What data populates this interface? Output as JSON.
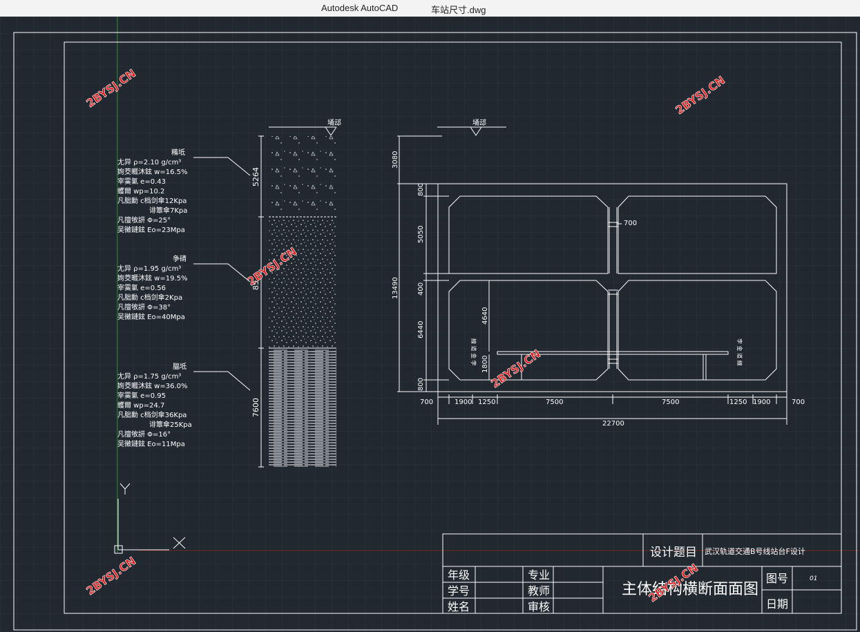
{
  "window": {
    "app_name": "Autodesk AutoCAD",
    "file_name": "车站尺寸.dwg"
  },
  "colors": {
    "background": "#212830",
    "grid": "#2a323c",
    "line": "#ffffff",
    "watermark_fill": "#e02020"
  },
  "watermark": "2BYSJ.CN",
  "ground_label": "埇䢵",
  "soil_column": {
    "depths": {
      "layer1": "5264",
      "layer2": "85",
      "layer3": "7600"
    },
    "layer1": {
      "name": "糒坻",
      "props": [
        "尢异 ρ=2.10 g/cm³",
        "姰茭畷沐鉉 w=16.5%",
        "宰霙氭 e=0.43",
        "蠖爾 wp=10.2",
        "凡朏勳 c档剑傘12Kpa",
        "诽簟傘7Kpa",
        "凡擅敂訮 Φ=25°",
        "吴黴鏈鉉 Eo=23Mpa"
      ]
    },
    "layer2": {
      "name": "争碃",
      "props": [
        "尢异 ρ=1.95 g/cm³",
        "姰茭畷沐鉉 w=19.5%",
        "宰霙氭 e=0.56",
        "凡朏勳 c档剑傘2Kpa",
        "凡擅敂訮 Φ=38°",
        "吴黴鏈鉉 Eo=40Mpa"
      ]
    },
    "layer3": {
      "name": "腷坻",
      "props": [
        "尢异 ρ=1.75 g/cm³",
        "姰茭畷沐鉉 w=36.0%",
        "宰霙氭 e=0.95",
        "蠖爾 wp=24.7",
        "凡朏勳 c档剑傘36Kpa",
        "诽簟傘25Kpa",
        "凡擅敂訮 Φ=16°",
        "吴黴鏈鉉 Eo=11Mpa"
      ]
    }
  },
  "station_section": {
    "dims_vertical": {
      "cover": "3080",
      "top_slab": "800",
      "upper_story": "5050",
      "mid_slab": "400",
      "lower_story": "6440",
      "bottom_slab": "800",
      "total_height": "13490",
      "inner_4640": "4640",
      "platform_1800": "1800"
    },
    "dims_horizontal": {
      "wall_left": "700",
      "track_left": "1900",
      "gap_left": "1250",
      "half_left": "7500",
      "half_right": "7500",
      "gap_right": "1250",
      "track_right": "1900",
      "wall_right": "700",
      "total_width": "22700"
    },
    "column_width": "700",
    "track_label_left": "線 道 金 孛",
    "track_label_right": "孛 金 道 線"
  },
  "title_block": {
    "design_topic_label": "设计题目",
    "design_topic": "武汉轨道交通B号线站台F设计",
    "grade_label": "年级",
    "student_id_label": "学号",
    "name_label": "姓名",
    "major_label": "专业",
    "teacher_label": "教师",
    "reviewer_label": "审核",
    "drawing_title": "主体结构横断面面图",
    "drawing_no_label": "图号",
    "drawing_no": "01",
    "date_label": "日期"
  },
  "ucs": {
    "y_label": "Y",
    "x_label": "X"
  }
}
